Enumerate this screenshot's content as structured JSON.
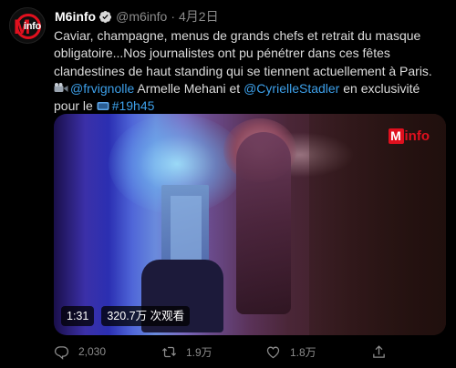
{
  "tweet": {
    "author_name": "M6info",
    "author_handle": "@m6info",
    "separator": "·",
    "date": "4月2日",
    "text_part1": "Caviar, champagne, menus de grands chefs et retrait du masque obligatoire...Nos journalistes ont pu pénétrer dans ces fêtes clandestines de haut standing qui se tiennent actuellement à Paris.",
    "mention1": "@frvignolle",
    "text_part2": " Armelle Mehani et ",
    "mention2": "@CyrielleStadler",
    "text_part3": " en exclusivité pour le ",
    "hashtag": "#19h45"
  },
  "avatar": {
    "brand_letter": "M",
    "brand_text": "info"
  },
  "video": {
    "watermark_letter": "M",
    "watermark_text": "info",
    "duration": "1:31",
    "views": "320.7万 次观看"
  },
  "actions": {
    "reply_count": "2,030",
    "retweet_count": "1.9万",
    "like_count": "1.8万"
  },
  "colors": {
    "brand_red": "#e0101e",
    "link_blue": "#3da0ea",
    "muted": "#8b8b8b"
  },
  "icons": [
    "verified-badge-icon",
    "video-camera-emoji-icon",
    "tv-emoji-icon",
    "reply-icon",
    "retweet-icon",
    "like-icon",
    "share-icon"
  ]
}
